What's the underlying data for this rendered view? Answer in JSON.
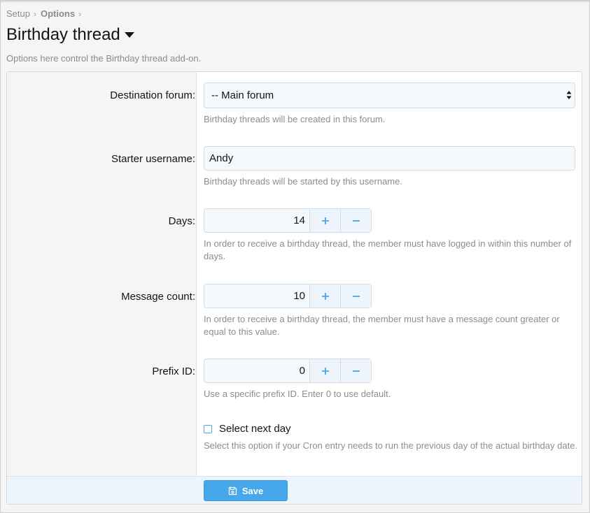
{
  "breadcrumb": {
    "items": [
      "Setup",
      "Options"
    ]
  },
  "header": {
    "title": "Birthday thread",
    "description": "Options here control the Birthday thread add-on."
  },
  "form": {
    "destination_forum": {
      "label": "Destination forum:",
      "value": "-- Main forum",
      "hint": "Birthday threads will be created in this forum."
    },
    "starter_username": {
      "label": "Starter username:",
      "value": "Andy",
      "hint": "Birthday threads will be started by this username."
    },
    "days": {
      "label": "Days:",
      "value": "14",
      "hint": "In order to receive a birthday thread, the member must have logged in within this number of days."
    },
    "message_count": {
      "label": "Message count:",
      "value": "10",
      "hint": "In order to receive a birthday thread, the member must have a message count greater or equal to this value."
    },
    "prefix_id": {
      "label": "Prefix ID:",
      "value": "0",
      "hint": "Use a specific prefix ID. Enter 0 to use default."
    },
    "select_next_day": {
      "label": "Select next day",
      "checked": false,
      "hint": "Select this option if your Cron entry needs to run the previous day of the actual birthday date."
    }
  },
  "footer": {
    "save_label": "Save"
  },
  "icons": {
    "increment": "plus-icon",
    "decrement": "minus-icon",
    "save": "save-icon",
    "title_menu": "caret-down-icon",
    "select_arrows": "select-arrows-icon"
  },
  "colors": {
    "accent": "#47a7eb",
    "input_bg": "#f4f9fe",
    "footer_bg": "#edf4fc"
  }
}
